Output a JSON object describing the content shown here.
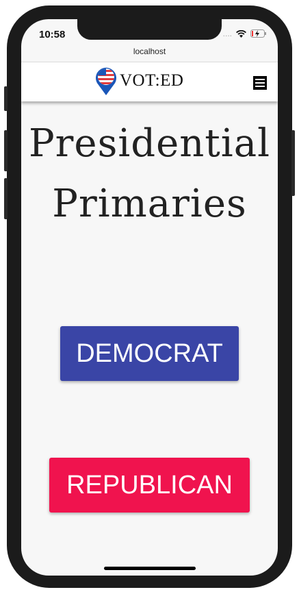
{
  "status": {
    "time": "10:58",
    "signal": "....",
    "wifi": "wifi-icon",
    "battery": "battery-charging-icon"
  },
  "browser": {
    "url": "localhost"
  },
  "header": {
    "logo_text": "VOT:ED",
    "menu_icon": "hamburger-menu-icon"
  },
  "main": {
    "title": "Presidential Primaries",
    "buttons": [
      {
        "label": "DEMOCRAT",
        "color": "#3a45a6"
      },
      {
        "label": "REPUBLICAN",
        "color": "#f0134e"
      }
    ]
  }
}
